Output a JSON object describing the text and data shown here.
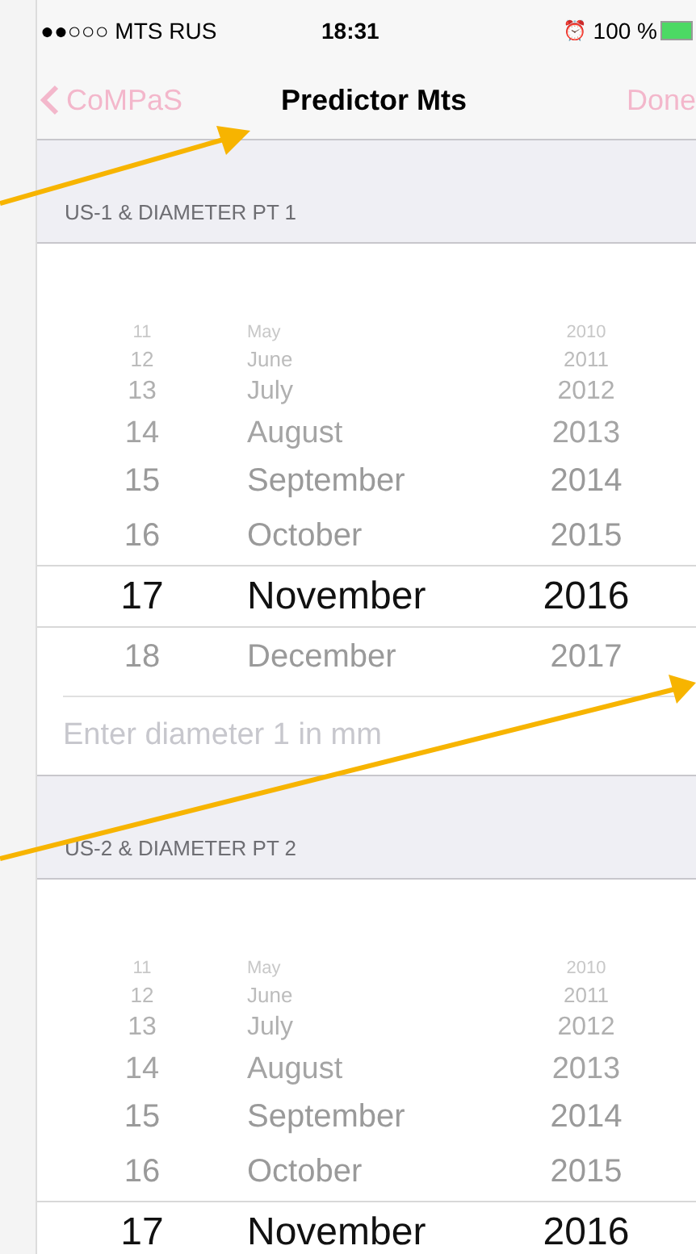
{
  "status_bar": {
    "carrier": "●●○○○ MTS RUS",
    "time": "18:31",
    "alarm": "⏰",
    "battery": "100 %"
  },
  "nav": {
    "back": "CoMPaS",
    "title": "Predictor Mts",
    "action": "Done"
  },
  "sections": [
    {
      "header": "US-1 & DIAMETER PT 1",
      "picker": [
        {
          "day": "11",
          "month": "May",
          "year": "2010",
          "selected": false
        },
        {
          "day": "12",
          "month": "June",
          "year": "2011",
          "selected": false
        },
        {
          "day": "13",
          "month": "July",
          "year": "2012",
          "selected": false
        },
        {
          "day": "14",
          "month": "August",
          "year": "2013",
          "selected": false
        },
        {
          "day": "15",
          "month": "September",
          "year": "2014",
          "selected": false
        },
        {
          "day": "16",
          "month": "October",
          "year": "2015",
          "selected": false
        },
        {
          "day": "17",
          "month": "November",
          "year": "2016",
          "selected": true
        },
        {
          "day": "18",
          "month": "December",
          "year": "2017",
          "selected": false
        }
      ],
      "input": {
        "placeholder": "Enter diameter 1 in mm"
      }
    },
    {
      "header": "US-2 & DIAMETER PT 2",
      "picker": [
        {
          "day": "11",
          "month": "May",
          "year": "2010",
          "selected": false
        },
        {
          "day": "12",
          "month": "June",
          "year": "2011",
          "selected": false
        },
        {
          "day": "13",
          "month": "July",
          "year": "2012",
          "selected": false
        },
        {
          "day": "14",
          "month": "August",
          "year": "2013",
          "selected": false
        },
        {
          "day": "15",
          "month": "September",
          "year": "2014",
          "selected": false
        },
        {
          "day": "16",
          "month": "October",
          "year": "2015",
          "selected": false
        },
        {
          "day": "17",
          "month": "November",
          "year": "2016",
          "selected": true
        }
      ]
    }
  ]
}
